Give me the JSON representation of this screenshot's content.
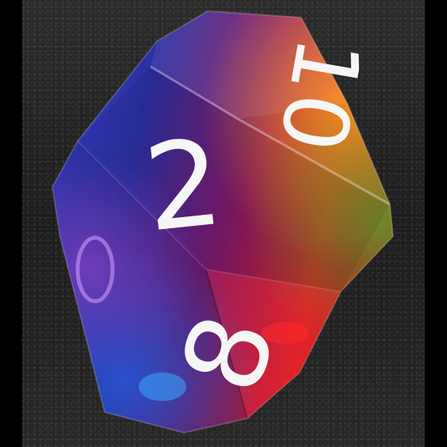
{
  "photo": {
    "subject_icon": "d10-die-icon",
    "background": "dark-felt",
    "die_faces": [
      "10",
      "2",
      "8"
    ],
    "colors": {
      "blue": "#2a3fbf",
      "purple": "#5a2a9a",
      "red": "#d01f2a",
      "orange": "#f08a10",
      "green": "#4a8a2a",
      "numerals": "#f4f4f4"
    }
  }
}
